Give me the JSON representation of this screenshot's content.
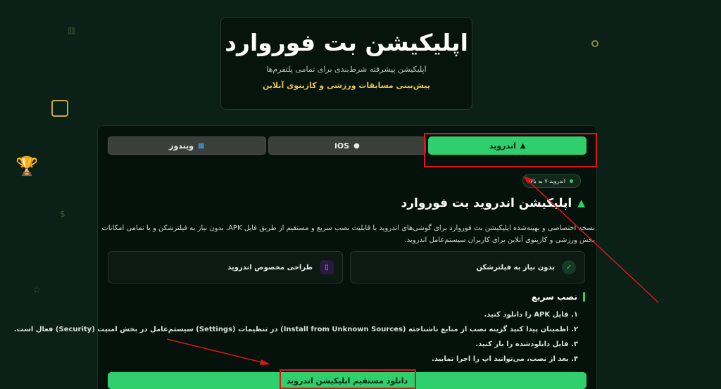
{
  "hero": {
    "title": "اپلیکیشن بت فوروارد",
    "subtitle": "اپلیکیشن پیشرفته شرط‌بندی برای تمامی پلتفرم‌ها",
    "tagline": "پیش‌بینی مسابقات ورزشی و کازینوی آنلاین"
  },
  "tabs": [
    {
      "label": "اندروید",
      "icon": "android-icon",
      "active": true
    },
    {
      "label": "iOS",
      "icon": "apple-icon",
      "active": false
    },
    {
      "label": "ویندوز",
      "icon": "windows-icon",
      "active": false
    }
  ],
  "badge": {
    "label": "اندروید ۷ به بالا"
  },
  "section": {
    "title": "اپلیکیشن اندروید بت فوروارد",
    "description": "نسخه اختصاصی و بهینه‌شده اپلیکیشن بت فوروارد برای گوشی‌های اندروید با قابلیت نصب سریع و مستقیم از طریق فایل APK، بدون نیاز به فیلترشکن و با تمامی امکانات بخش ورزشی و کازینوی آنلاین برای کاربران سیستم‌عامل اندروید."
  },
  "features": [
    {
      "label": "بدون نیاز به فیلترشکن",
      "icon": "shield-check-icon"
    },
    {
      "label": "طراحی مخصوص اندروید",
      "icon": "phone-icon"
    }
  ],
  "quick_install": {
    "title": "نصب سریع",
    "steps": [
      "۱. فایل APK را دانلود کنید.",
      "۲. اطمینان پیدا کنید گزینه نصب از منابع ناشناخته (Install from Unknown Sources) در تنظیمات (Settings) سیستم‌عامل در بخش امنیت (Security) فعال است.",
      "۳. فایل دانلودشده را باز کنید.",
      "۴. بعد از نصب، می‌توانید اپ را اجرا نمایید."
    ]
  },
  "download_button": {
    "label": "دانلود مستقیم اپلیکیشن اندروید"
  },
  "colors": {
    "accent": "#2fcf6d",
    "background": "#0b2016",
    "annotation": "#e0141a",
    "gold": "#e6c25a"
  }
}
